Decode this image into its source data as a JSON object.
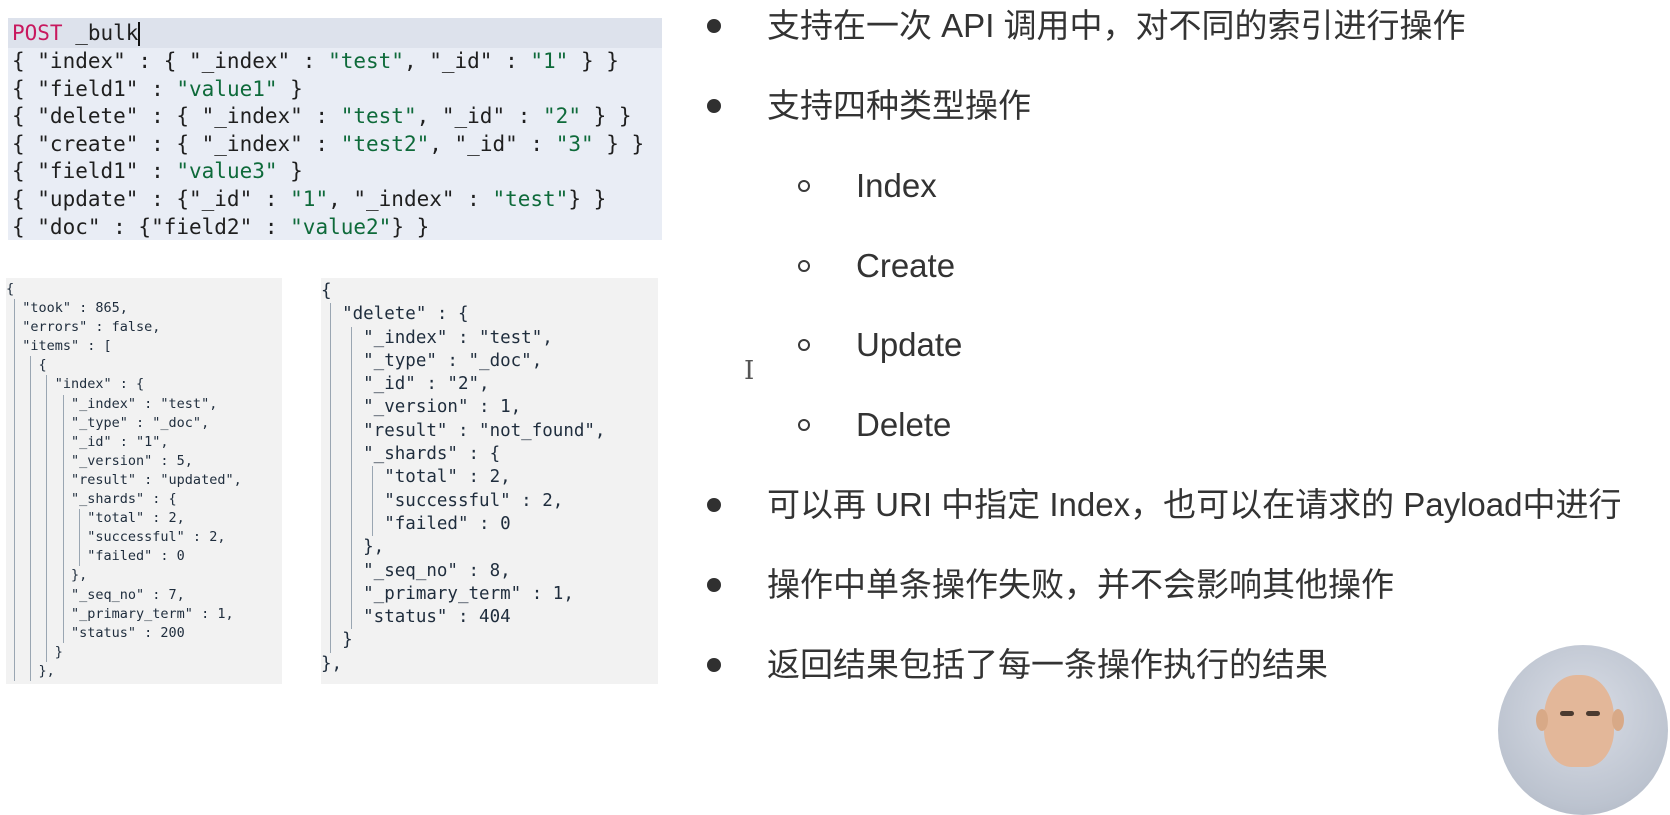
{
  "request": {
    "lines": [
      [
        {
          "t": "POST",
          "c": "m"
        },
        {
          "t": " _bulk"
        }
      ],
      [
        {
          "t": "{ \"index\" : { \"_index\" : "
        },
        {
          "t": "\"test\"",
          "c": "s"
        },
        {
          "t": ", \"_id\" : "
        },
        {
          "t": "\"1\"",
          "c": "s"
        },
        {
          "t": " } }"
        }
      ],
      [
        {
          "t": "{ \"field1\" : "
        },
        {
          "t": "\"value1\"",
          "c": "s"
        },
        {
          "t": " }"
        }
      ],
      [
        {
          "t": "{ \"delete\" : { \"_index\" : "
        },
        {
          "t": "\"test\"",
          "c": "s"
        },
        {
          "t": ", \"_id\" : "
        },
        {
          "t": "\"2\"",
          "c": "s"
        },
        {
          "t": " } }"
        }
      ],
      [
        {
          "t": "{ \"create\" : { \"_index\" : "
        },
        {
          "t": "\"test2\"",
          "c": "s"
        },
        {
          "t": ", \"_id\" : "
        },
        {
          "t": "\"3\"",
          "c": "s"
        },
        {
          "t": " } }"
        }
      ],
      [
        {
          "t": "{ \"field1\" : "
        },
        {
          "t": "\"value3\"",
          "c": "s"
        },
        {
          "t": " }"
        }
      ],
      [
        {
          "t": "{ \"update\" : {\"_id\" : "
        },
        {
          "t": "\"1\"",
          "c": "s"
        },
        {
          "t": ", \"_index\" : "
        },
        {
          "t": "\"test\"",
          "c": "s"
        },
        {
          "t": "} }"
        }
      ],
      [
        {
          "t": "{ \"doc\" : {\"field2\" : "
        },
        {
          "t": "\"value2\"",
          "c": "s"
        },
        {
          "t": "} }"
        }
      ]
    ]
  },
  "response1": {
    "lines": [
      "{",
      "  \"took\" : 865,",
      "  \"errors\" : false,",
      "  \"items\" : [",
      "    {",
      "      \"index\" : {",
      "        \"_index\" : \"test\",",
      "        \"_type\" : \"_doc\",",
      "        \"_id\" : \"1\",",
      "        \"_version\" : 5,",
      "        \"result\" : \"updated\",",
      "        \"_shards\" : {",
      "          \"total\" : 2,",
      "          \"successful\" : 2,",
      "          \"failed\" : 0",
      "        },",
      "        \"_seq_no\" : 7,",
      "        \"_primary_term\" : 1,",
      "        \"status\" : 200",
      "      }",
      "    },"
    ]
  },
  "response2": {
    "lines": [
      "{",
      "  \"delete\" : {",
      "    \"_index\" : \"test\",",
      "    \"_type\" : \"_doc\",",
      "    \"_id\" : \"2\",",
      "    \"_version\" : 1,",
      "    \"result\" : \"not_found\",",
      "    \"_shards\" : {",
      "      \"total\" : 2,",
      "      \"successful\" : 2,",
      "      \"failed\" : 0",
      "    },",
      "    \"_seq_no\" : 8,",
      "    \"_primary_term\" : 1,",
      "    \"status\" : 404",
      "  }",
      "},"
    ]
  },
  "bullets": [
    {
      "level": 1,
      "text": "支持在一次 API 调用中，对不同的索引进行操作"
    },
    {
      "level": 1,
      "text": "支持四种类型操作"
    },
    {
      "level": 2,
      "text": "Index"
    },
    {
      "level": 2,
      "text": "Create"
    },
    {
      "level": 2,
      "text": "Update"
    },
    {
      "level": 2,
      "text": "Delete"
    },
    {
      "level": 1,
      "text": "可以再 URI 中指定 Index，也可以在请求的 Payload中进行"
    },
    {
      "level": 1,
      "text": "操作中单条操作失败，并不会影响其他操作"
    },
    {
      "level": 1,
      "text": "返回结果包括了每一条操作执行的结果"
    }
  ],
  "colors": {
    "method": "#c8185e",
    "string": "#0e6a3a",
    "editor_bg": "#e9edf5",
    "response_bg": "#f2f2f2"
  },
  "cursor_icon": "text-cursor-icon",
  "webcam": "presenter-webcam"
}
